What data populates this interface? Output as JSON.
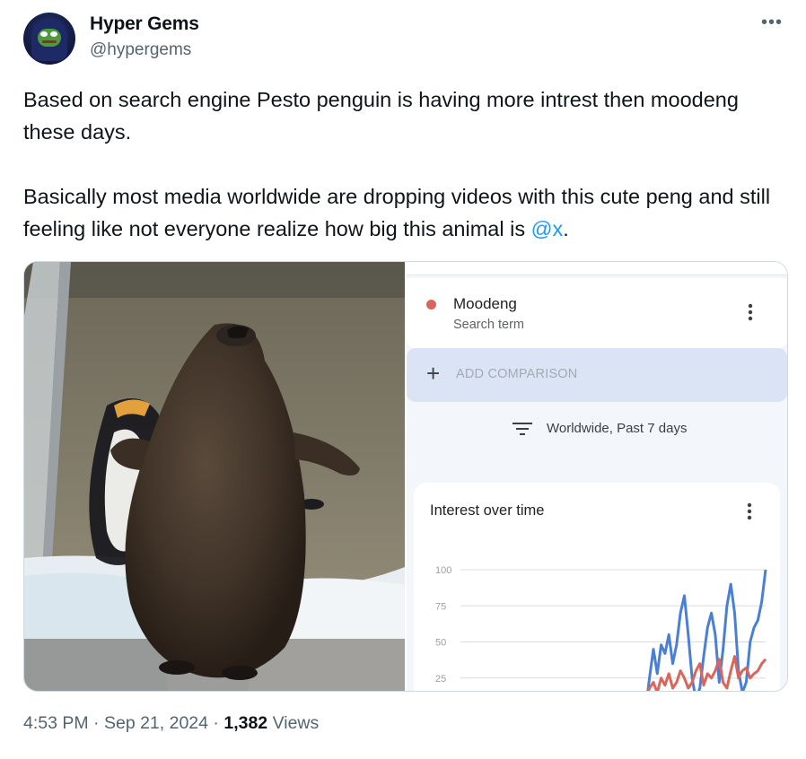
{
  "author": {
    "name": "Hyper Gems",
    "handle": "@hypergems"
  },
  "tweet": {
    "para1": "Based on search engine Pesto penguin is having more intrest then moodeng these days.",
    "para2_before": "Basically most media worldwide are dropping videos with this cute peng and still feeling like not everyone realize how big this animal is ",
    "mention": "@x",
    "para2_after": "."
  },
  "icons": {
    "more": "more-horizontal-icon",
    "filter": "filter-icon",
    "add": "plus-icon",
    "kebab": "kebab-menu-icon"
  },
  "colors": {
    "moodeng": "#d9655b",
    "pesto": "#4a7fd6",
    "mention": "#1d9bf0"
  },
  "trends": {
    "term": {
      "name": "Moodeng",
      "sub": "Search term"
    },
    "add_comparison": "ADD COMPARISON",
    "filter": "Worldwide, Past 7 days",
    "chart_title": "Interest over time"
  },
  "chart_data": {
    "type": "line",
    "title": "Interest over time",
    "ylim": [
      0,
      100
    ],
    "yticks": [
      "100",
      "75",
      "50",
      "25"
    ],
    "series": [
      {
        "color": "#4a7fd6",
        "values": [
          0,
          0,
          0,
          0,
          0,
          0,
          0,
          0,
          0,
          0,
          0,
          0,
          0,
          0,
          0,
          0,
          0,
          0,
          0,
          0,
          0,
          0,
          0,
          0,
          0,
          0,
          0,
          0,
          0,
          0,
          0,
          0,
          0,
          0,
          0,
          0,
          0,
          0,
          0,
          0,
          0,
          0,
          0,
          0,
          5,
          10,
          3,
          25,
          45,
          28,
          48,
          42,
          55,
          35,
          48,
          70,
          82,
          55,
          25,
          10,
          18,
          40,
          60,
          70,
          55,
          22,
          45,
          75,
          90,
          70,
          30,
          15,
          22,
          50,
          60,
          65,
          78,
          100
        ]
      },
      {
        "color": "#d9655b",
        "values": [
          5,
          2,
          0,
          0,
          0,
          0,
          0,
          0,
          0,
          0,
          0,
          0,
          0,
          0,
          0,
          0,
          0,
          0,
          0,
          0,
          0,
          0,
          0,
          0,
          0,
          0,
          0,
          0,
          0,
          0,
          0,
          0,
          0,
          0,
          0,
          0,
          0,
          0,
          0,
          0,
          0,
          0,
          0,
          3,
          6,
          15,
          10,
          18,
          22,
          15,
          25,
          20,
          28,
          18,
          22,
          30,
          25,
          18,
          22,
          30,
          35,
          20,
          28,
          25,
          30,
          38,
          22,
          18,
          30,
          40,
          25,
          30,
          32,
          25,
          28,
          30,
          35,
          38
        ]
      }
    ]
  },
  "footer": {
    "time": "4:53 PM",
    "date": "Sep 21, 2024",
    "views_count": "1,382",
    "views_label": "Views"
  }
}
